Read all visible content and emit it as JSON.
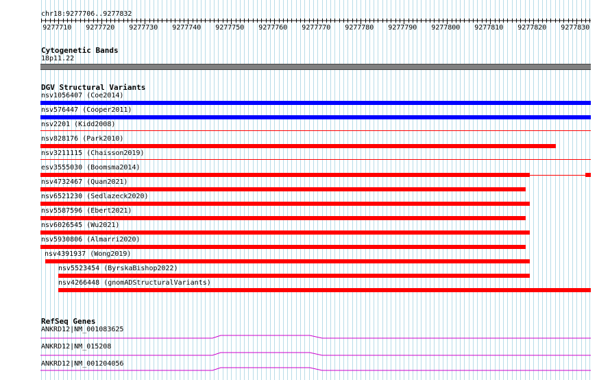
{
  "ruler": {
    "position_text": "chr18:9277706..9277832",
    "ticks": [
      "9277710",
      "9277720",
      "9277730",
      "9277740",
      "9277750",
      "9277760",
      "9277770",
      "9277780",
      "9277790",
      "9277800",
      "9277810",
      "9277820",
      "9277830"
    ]
  },
  "cytoband": {
    "title": "Cytogenetic Bands",
    "band_label": "18p11.22",
    "band_color": "#808080"
  },
  "dgv": {
    "title": "DGV Structural Variants",
    "variants": [
      {
        "label": "nsv1056407 (Coe2014)",
        "color": "#0000ff"
      },
      {
        "label": "nsv576447 (Cooper2011)",
        "color": "#0000ff"
      },
      {
        "label": "nsv2201 (Kidd2008)",
        "color": "#ff0000"
      },
      {
        "label": "nsv828176 (Park2010)",
        "color": "#ff0000"
      },
      {
        "label": "nsv3211115 (Chaisson2019)",
        "color": "#ff0000"
      },
      {
        "label": "esv3555030 (Boomsma2014)",
        "color": "#ff0000"
      },
      {
        "label": "nsv4732467 (Quan2021)",
        "color": "#ff0000"
      },
      {
        "label": "nsv6521230 (Sedlazeck2020)",
        "color": "#ff0000"
      },
      {
        "label": "nsv5587596 (Ebert2021)",
        "color": "#ff0000"
      },
      {
        "label": "nsv6026545 (Wu2021)",
        "color": "#ff0000"
      },
      {
        "label": "nsv5930806 (Almarri2020)",
        "color": "#ff0000"
      },
      {
        "label": "nsv4391937 (Wong2019)",
        "color": "#ff0000"
      },
      {
        "label": "nsv5523454 (ByrskaBishop2022)",
        "color": "#ff0000"
      },
      {
        "label": "nsv4266448 (gnomADStructuralVariants)",
        "color": "#ff0000"
      }
    ]
  },
  "refseq": {
    "title": "RefSeq Genes",
    "color": "#cc00cc",
    "genes": [
      {
        "label": "ANKRD12|NM_001083625"
      },
      {
        "label": "ANKRD12|NM_015208"
      },
      {
        "label": "ANKRD12|NM_001204056"
      }
    ]
  }
}
